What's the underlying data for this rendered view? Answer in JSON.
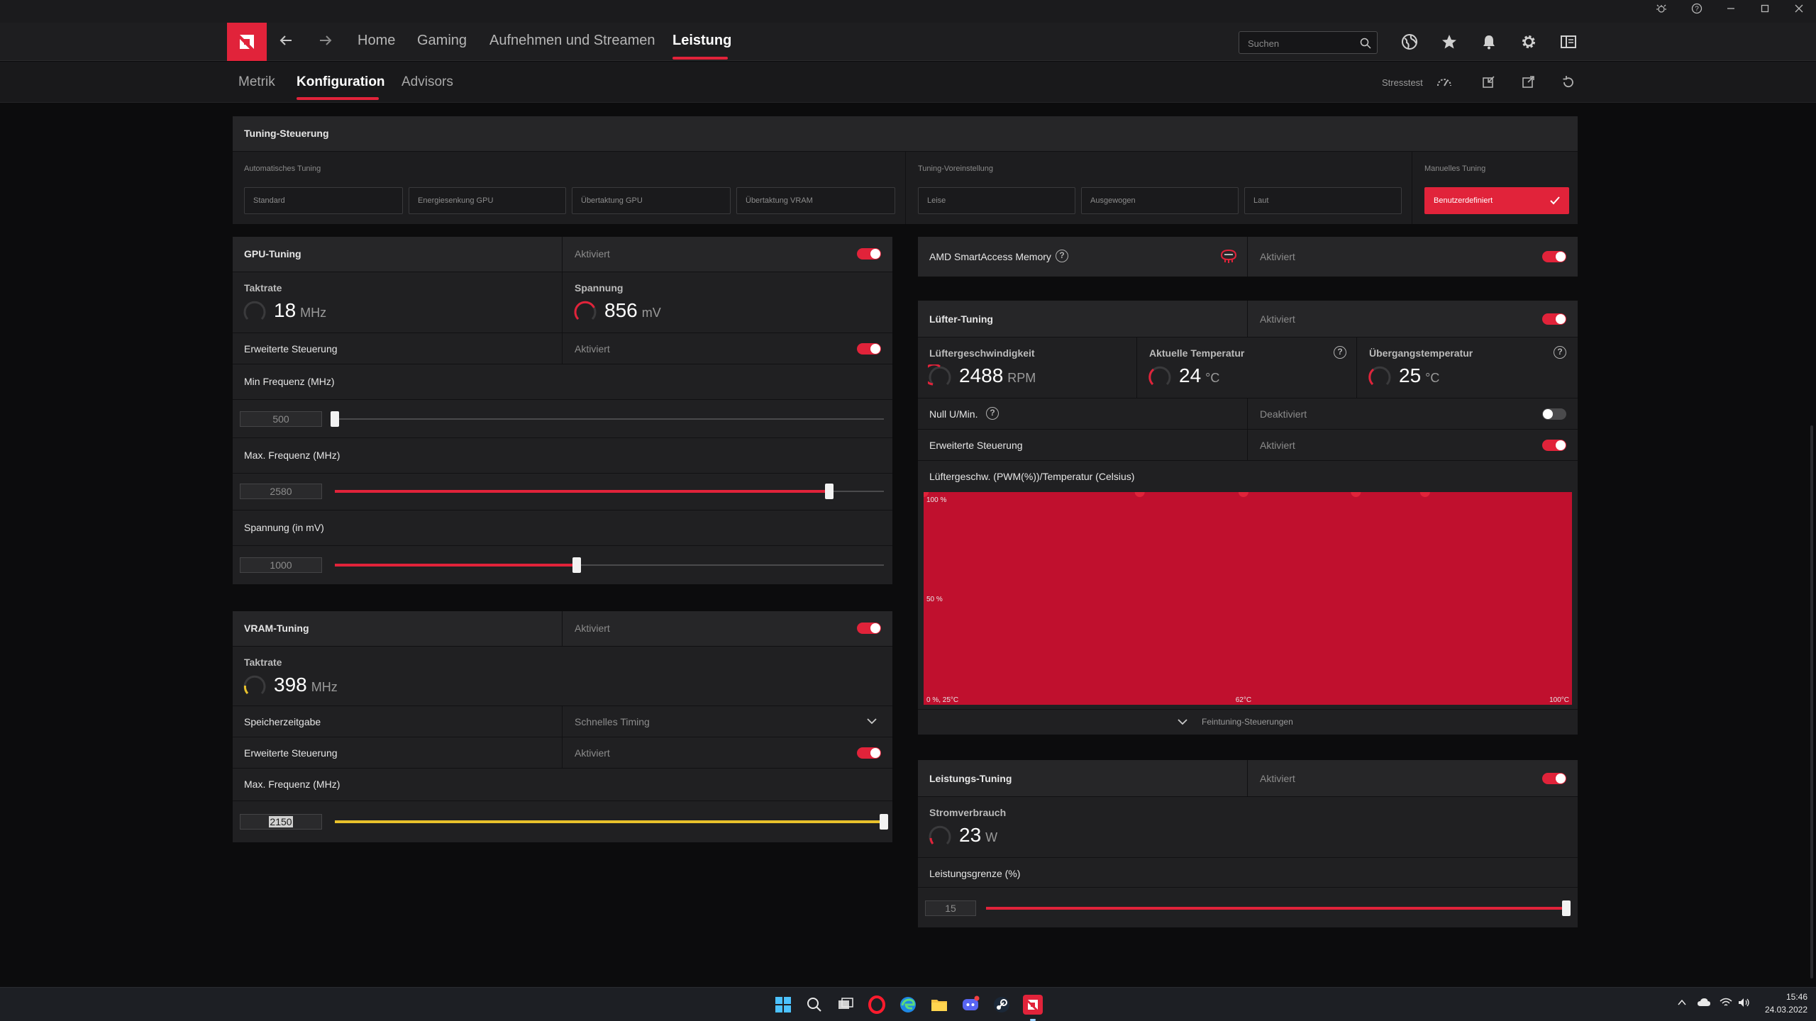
{
  "nav": {
    "tabs": [
      {
        "label": "Home"
      },
      {
        "label": "Gaming"
      },
      {
        "label": "Aufnehmen und Streamen"
      },
      {
        "label": "Leistung"
      }
    ],
    "search_placeholder": "Suchen"
  },
  "subnav": {
    "tabs": [
      {
        "label": "Metrik"
      },
      {
        "label": "Konfiguration"
      },
      {
        "label": "Advisors"
      }
    ],
    "stresstest_label": "Stresstest"
  },
  "tuning_control": {
    "title": "Tuning-Steuerung",
    "auto_label": "Automatisches Tuning",
    "auto_buttons": [
      "Standard",
      "Energiesenkung GPU",
      "Übertaktung GPU",
      "Übertaktung VRAM"
    ],
    "preset_label": "Tuning-Voreinstellung",
    "preset_buttons": [
      "Leise",
      "Ausgewogen",
      "Laut"
    ],
    "manual_label": "Manuelles Tuning",
    "manual_button": "Benutzerdefiniert"
  },
  "gpu_tuning": {
    "title": "GPU-Tuning",
    "status": "Aktiviert",
    "clock_label": "Taktrate",
    "clock_value": "18",
    "clock_unit": "MHz",
    "voltage_label": "Spannung",
    "voltage_value": "856",
    "voltage_unit": "mV",
    "advanced_label": "Erweiterte Steuerung",
    "advanced_status": "Aktiviert",
    "min_freq_label": "Min Frequenz (MHz)",
    "min_freq_value": "500",
    "max_freq_label": "Max. Frequenz (MHz)",
    "max_freq_value": "2580",
    "volt_label": "Spannung (in mV)",
    "volt_value": "1000"
  },
  "vram_tuning": {
    "title": "VRAM-Tuning",
    "status": "Aktiviert",
    "clock_label": "Taktrate",
    "clock_value": "398",
    "clock_unit": "MHz",
    "timing_label": "Speicherzeitgabe",
    "timing_value": "Schnelles Timing",
    "advanced_label": "Erweiterte Steuerung",
    "advanced_status": "Aktiviert",
    "max_freq_label": "Max. Frequenz (MHz)",
    "max_freq_value": "2150"
  },
  "sam": {
    "title": "AMD SmartAccess Memory",
    "status": "Aktiviert"
  },
  "fan_tuning": {
    "title": "Lüfter-Tuning",
    "status": "Aktiviert",
    "speed_label": "Lüftergeschwindigkeit",
    "speed_value": "2488",
    "speed_unit": "RPM",
    "temp_label": "Aktuelle Temperatur",
    "temp_value": "24",
    "temp_unit": "°C",
    "junction_label": "Übergangstemperatur",
    "junction_value": "25",
    "junction_unit": "°C",
    "zero_rpm_label": "Null U/Min.",
    "zero_rpm_status": "Deaktiviert",
    "advanced_label": "Erweiterte Steuerung",
    "advanced_status": "Aktiviert",
    "curve_label": "Lüftergeschw. (PWM(%))/Temperatur (Celsius)",
    "fine_tuning_label": "Feintuning-Steuerungen"
  },
  "chart_data": {
    "type": "area",
    "x": [
      25,
      50,
      62,
      75,
      83
    ],
    "y": [
      100,
      100,
      100,
      100,
      100
    ],
    "xlim": [
      25,
      100
    ],
    "ylim": [
      0,
      100
    ],
    "y_tick_labels": [
      "100 %",
      "50 %"
    ],
    "x_tick_labels": [
      "0 %, 25°C",
      "62°C",
      "100°C"
    ],
    "fill_color": "#c0102e",
    "point_color": "#e1233a"
  },
  "power_tuning": {
    "title": "Leistungs-Tuning",
    "status": "Aktiviert",
    "consumption_label": "Stromverbrauch",
    "consumption_value": "23",
    "consumption_unit": "W",
    "limit_label": "Leistungsgrenze (%)",
    "limit_value": "15"
  },
  "sliders": {
    "gpu_min_freq": 0.0,
    "gpu_max_freq": 0.9,
    "gpu_voltage": 0.44,
    "vram_max_freq": 1.0,
    "power_limit": 1.0
  },
  "taskbar": {
    "time": "15:46",
    "date": "24.03.2022"
  },
  "colors": {
    "accent": "#e1233a",
    "vram_accent": "#e8c12c"
  }
}
